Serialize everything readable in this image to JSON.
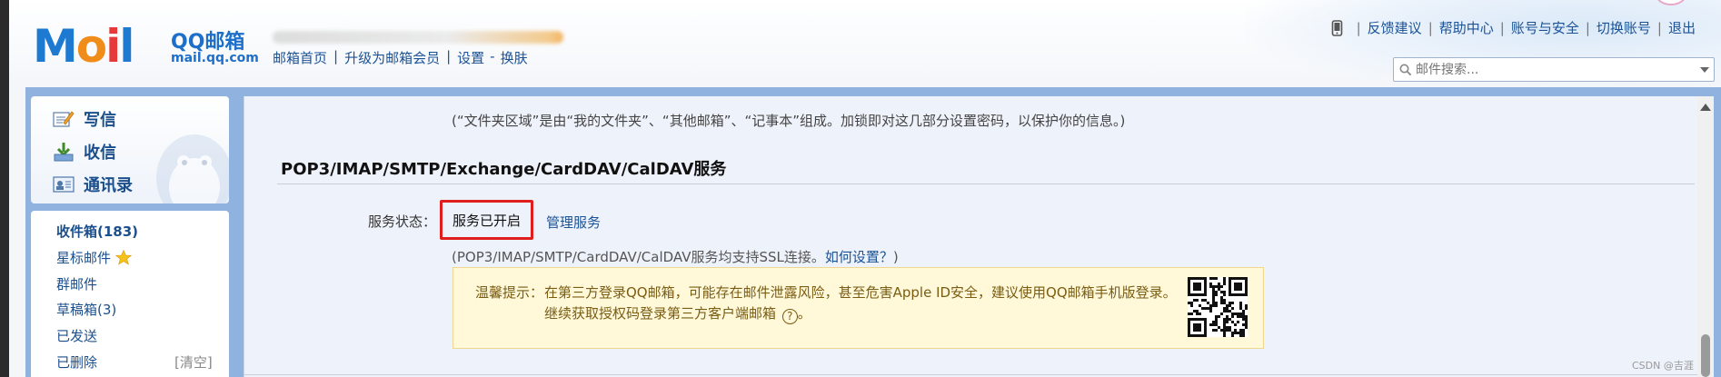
{
  "header": {
    "logo_text": "M",
    "logo_text_o": "o",
    "logo_text_i": "i",
    "logo_text_l": "l",
    "brand": "QQ邮箱",
    "brand_url": "mail.qq.com",
    "nav": {
      "home": "邮箱首页",
      "upgrade": "升级为邮箱会员",
      "settings": "设置",
      "dash": "-",
      "skin": "换肤"
    },
    "right_links": {
      "feedback": "反馈建议",
      "help": "帮助中心",
      "account_security": "账号与安全",
      "switch_account": "切换账号",
      "logout": "退出"
    },
    "search_placeholder": "邮件搜索..."
  },
  "sidebar": {
    "actions": {
      "compose": "写信",
      "inbox_action": "收信",
      "contacts": "通讯录"
    },
    "folders": {
      "inbox": "收件箱(183)",
      "starred": "星标邮件",
      "group": "群邮件",
      "drafts": "草稿箱(3)",
      "sent": "已发送",
      "deleted": "已删除",
      "clear": "[清空]"
    }
  },
  "main": {
    "folder_desc": "(“文件夹区域”是由“我的文件夹”、“其他邮箱”、“记事本”组成。加锁即对这几部分设置密码，以保护你的信息。)",
    "section_title": "POP3/IMAP/SMTP/Exchange/CardDAV/CalDAV服务",
    "status_label": "服务状态：",
    "status_value": "服务已开启",
    "manage_link": "管理服务",
    "ssl_note_prefix": "(POP3/IMAP/SMTP/CardDAV/CalDAV服务均支持SSL连接。",
    "ssl_note_link": "如何设置？",
    "ssl_note_suffix": ")",
    "tip_label": "温馨提示：",
    "tip_line1": "在第三方登录QQ邮箱，可能存在邮件泄露风险，甚至危害Apple ID安全，建议使用QQ邮箱手机版登录。",
    "tip_line2": "继续获取授权码登录第三方客户端邮箱",
    "tip_help_glyph": "?",
    "tip_line2_end": "。"
  },
  "watermark": "CSDN @吉涯",
  "colors": {
    "accent_blue": "#1b5296",
    "frame_blue": "#8fb3de",
    "highlight_red": "#e01e1e",
    "tip_bg": "#fff8d9"
  }
}
